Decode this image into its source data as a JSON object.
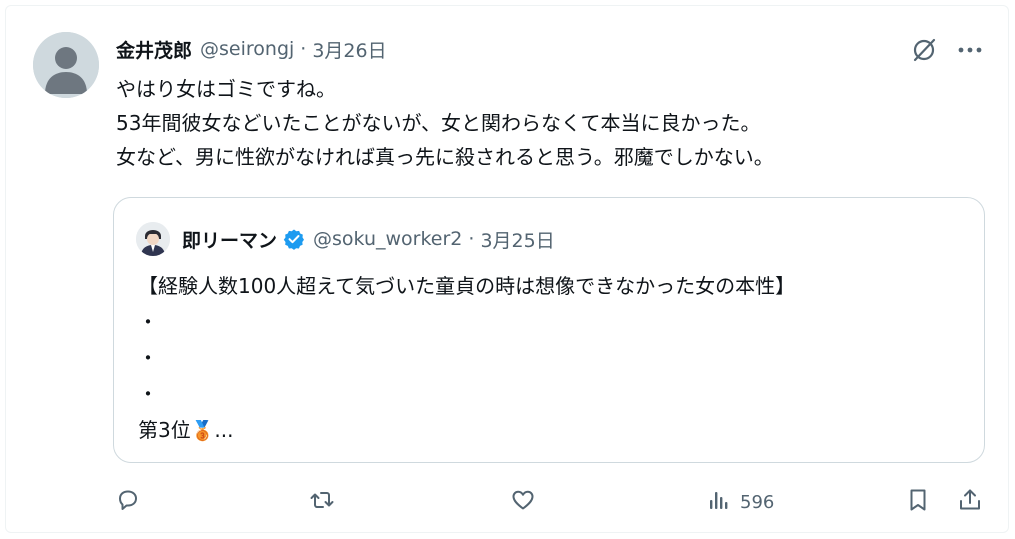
{
  "tweet": {
    "display_name": "金井茂郎",
    "handle": "@seirongj",
    "separator": "·",
    "date": "3月26日",
    "lines": [
      "やはり女はゴミですね。",
      "53年間彼女などいたことがないが、女と関わらなくて本当に良かった。",
      "女など、男に性欲がなければ真っ先に殺されると思う。邪魔でしかない。"
    ]
  },
  "quote": {
    "display_name": "即リーマン",
    "verified": true,
    "handle": "@soku_worker2",
    "separator": "·",
    "date": "3月25日",
    "lines": [
      "【経験人数100人超えて気づいた童貞の時は想像できなかった女の本性】",
      "・",
      "・",
      "・"
    ],
    "last_line_prefix": "第3位",
    "last_line_emoji": "🥉",
    "last_line_suffix": "..."
  },
  "actions": {
    "views": "596"
  },
  "icons": {
    "reply": "reply-icon",
    "retweet": "retweet-icon",
    "like": "heart-icon",
    "views": "views-icon",
    "bookmark": "bookmark-icon",
    "share": "share-icon",
    "grok": "grok-icon",
    "more": "more-icon"
  },
  "colors": {
    "text": "#0f1419",
    "secondary": "#536471",
    "border": "#cfd9de",
    "verified": "#1d9bf0",
    "avatar_bg": "#cfd9de"
  }
}
